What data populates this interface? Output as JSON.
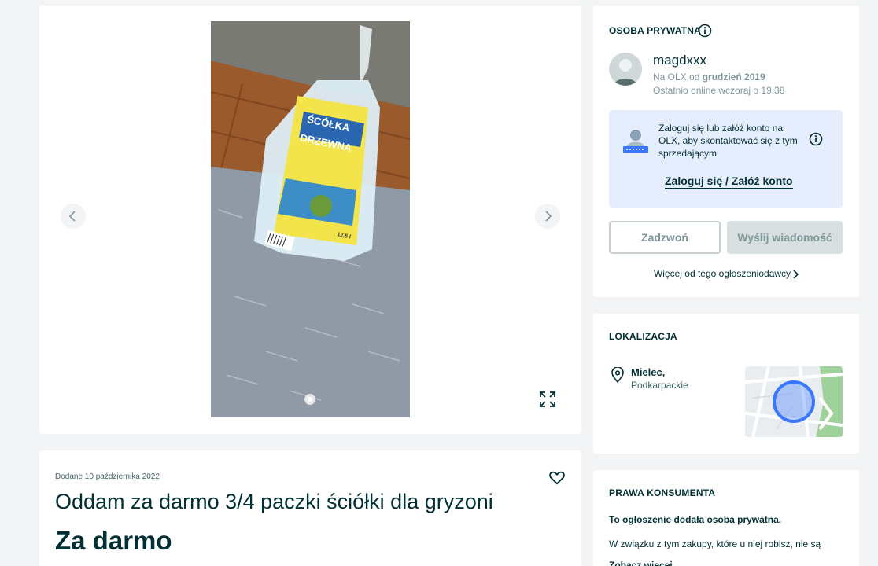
{
  "gallery": {
    "bag_text_line1": "ŚCÓŁKA",
    "bag_text_line2": "DRZEWNA",
    "bag_weight": "12,5 l"
  },
  "ad": {
    "date": "Dodane 10 października 2022",
    "title": "Oddam za darmo 3/4 paczki ściółki dla gryzoni",
    "price": "Za darmo"
  },
  "seller": {
    "section_title": "OSOBA PRYWATNA",
    "name": "magdxxx",
    "since_prefix": "Na OLX od ",
    "since_date": "grudzień 2019",
    "last_online": "Ostatnio online wczoraj o 19:38",
    "login_prompt": "Zaloguj się lub załóż konto na OLX, aby skontaktować się z tym sprzedającym",
    "login_link": "Zaloguj się / Załóż konto",
    "call_button": "Zadzwoń",
    "message_button": "Wyślij wiadomość",
    "more_ads": "Więcej od tego ogłoszeniodawcy"
  },
  "location": {
    "section_title": "LOKALIZACJA",
    "city": "Mielec,",
    "region": "Podkarpackie"
  },
  "consumer_rights": {
    "section_title": "PRAWA KONSUMENTA",
    "line1": "To ogłoszenie dodała osoba prywatna.",
    "line2": "W związku z tym zakupy, które u niej robisz, nie są",
    "more": "Zobacz więcej"
  },
  "colors": {
    "brand_dark": "#002f34",
    "page_bg": "#f2f4f5",
    "login_box_bg": "#e6eefe",
    "map_marker": "#3a77ff"
  }
}
